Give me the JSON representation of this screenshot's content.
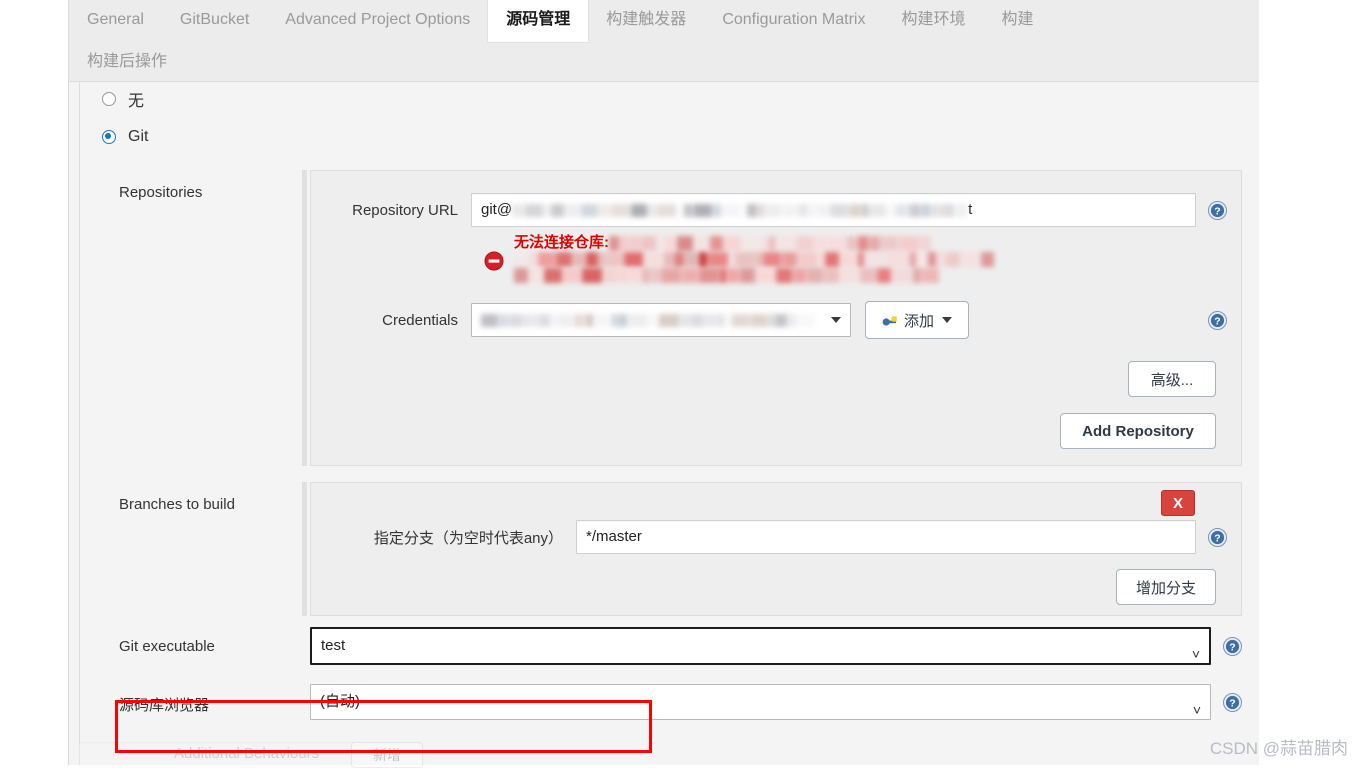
{
  "tabs": {
    "row1": [
      {
        "label": "General",
        "active": false
      },
      {
        "label": "GitBucket",
        "active": false
      },
      {
        "label": "Advanced Project Options",
        "active": false
      },
      {
        "label": "源码管理",
        "active": true
      },
      {
        "label": "构建触发器",
        "active": false
      },
      {
        "label": "Configuration Matrix",
        "active": false
      },
      {
        "label": "构建环境",
        "active": false
      },
      {
        "label": "构建",
        "active": false
      }
    ],
    "row2": [
      {
        "label": "构建后操作",
        "active": false
      }
    ]
  },
  "scm": {
    "options": [
      {
        "label": "无",
        "checked": false
      },
      {
        "label": "Git",
        "checked": true
      }
    ]
  },
  "repositories": {
    "section_label": "Repositories",
    "url_label": "Repository URL",
    "url_value_prefix": "git@",
    "url_value_suffix": "t",
    "url_redacted": true,
    "error": {
      "title": "无法连接仓库:",
      "redacted": true,
      "icon": "error-circle-icon"
    },
    "credentials_label": "Credentials",
    "credentials_value_redacted": true,
    "add_credentials_label": "添加",
    "advanced_label": "高级...",
    "add_repository_label": "Add Repository"
  },
  "branches": {
    "section_label": "Branches to build",
    "branch_label": "指定分支（为空时代表any）",
    "branch_value": "*/master",
    "add_branch_label": "增加分支",
    "remove_label": "X"
  },
  "git_executable": {
    "label": "Git executable",
    "value": "test",
    "highlighted": true
  },
  "repo_browser": {
    "label": "源码库浏览器",
    "value": "(自动)"
  },
  "additional_behaviours": {
    "label": "Additional Behaviours",
    "add_label": "新增"
  },
  "watermark": "CSDN @蒜苗腊肉",
  "colors": {
    "accent": "#1675d1",
    "error": "#e00000",
    "danger_button": "#d9433d",
    "annotation": "#ff0000",
    "panel_bg": "#eeeeee",
    "page_bg": "#f4f4f4"
  }
}
